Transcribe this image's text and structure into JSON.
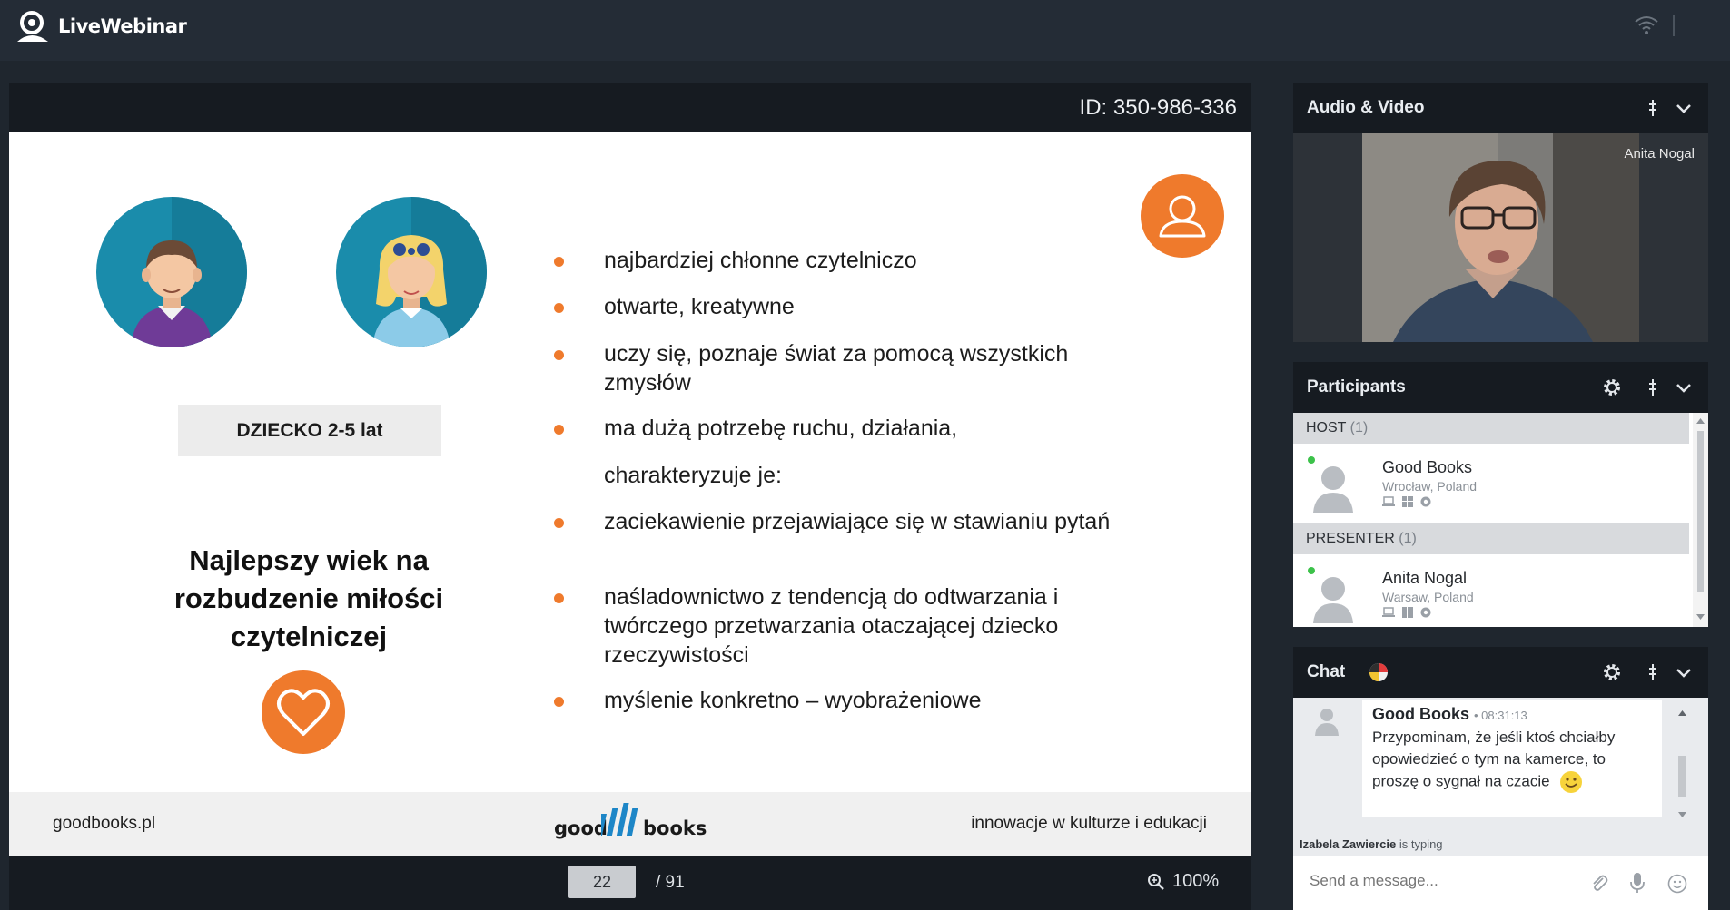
{
  "app": {
    "brand": "LiveWebinar"
  },
  "presentation": {
    "id_label": "ID: 350-986-336",
    "page_current": "22",
    "page_total": "/ 91",
    "zoom": "100%"
  },
  "slide": {
    "age_box": "DZIECKO 2-5 lat",
    "headline_lines": [
      "Najlepszy wiek na",
      "rozbudzenie miłości",
      "czytelniczej"
    ],
    "bullets": [
      "najbardziej chłonne czytelniczo",
      "otwarte, kreatywne",
      "uczy się, poznaje świat za pomocą wszystkich zmysłów",
      "ma dużą potrzebę ruchu, działania,",
      "charakteryzuje je:",
      "zaciekawienie przejawiające się w stawianiu pytań",
      "naśladownictwo z tendencją do odtwarzania i twórczego przetwarzania otaczającej dziecko rzeczywistości",
      "myślenie konkretno – wyobrażeniowe"
    ],
    "footer_left": "goodbooks.pl",
    "footer_logo_left": "good",
    "footer_logo_right": "books",
    "footer_right": "innowacje w kulturze i edukacji",
    "accent_color": "#ef7a2c"
  },
  "audio_video": {
    "title": "Audio & Video",
    "speaker_name": "Anita Nogal"
  },
  "participants": {
    "title": "Participants",
    "groups": [
      {
        "label": "HOST",
        "count": "(1)",
        "name": "Good Books",
        "location": "Wrocław, Poland"
      },
      {
        "label": "PRESENTER",
        "count": "(1)",
        "name": "Anita Nogal",
        "location": "Warsaw, Poland"
      }
    ]
  },
  "chat": {
    "title": "Chat",
    "message": {
      "author": "Good Books",
      "time": "• 08:31:13",
      "text": "Przypominam, że jeśli ktoś chciałby opowiedzieć o tym na kamerce, to proszę o sygnał na czacie"
    },
    "typing_name": "Izabela Zawiercie",
    "typing_suffix": " is typing",
    "input_placeholder": "Send a message..."
  }
}
